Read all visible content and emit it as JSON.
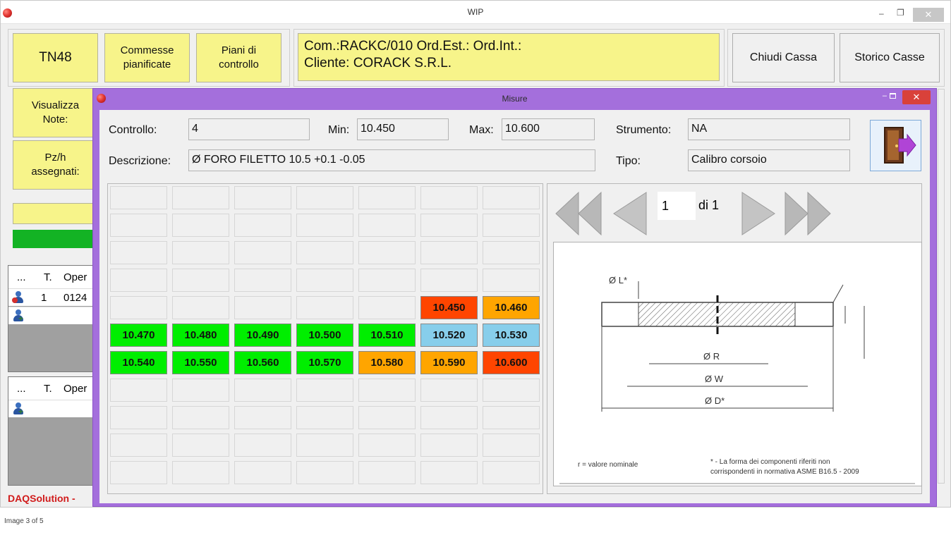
{
  "main": {
    "title": "WIP",
    "minimize_label": "–",
    "maximize_label": "❐",
    "close_label": "✕",
    "machine_btn": "TN48",
    "commesse_btn": "Commesse pianificate",
    "piani_btn": "Piani di controllo",
    "info_line1": "Com.:RACKC/010  Ord.Est.:  Ord.Int.:",
    "info_line2": "Cliente: CORACK S.R.L.",
    "chiudi_cassa": "Chiudi Cassa",
    "storico_casse": "Storico Casse",
    "visualizza_note": "Visualizza Note:",
    "pzh_assegnati": "Pz/h assegnati:",
    "grid1": {
      "col_dots": "...",
      "col_t": "T.",
      "col_oper": "Oper",
      "row1_t": "1",
      "row1_oper": "0124"
    },
    "grid2": {
      "col_dots": "...",
      "col_t": "T.",
      "col_oper": "Oper"
    },
    "status_text": "DAQSolution  -"
  },
  "dialog": {
    "title": "Misure",
    "controllo_label": "Controllo:",
    "controllo_value": "4",
    "min_label": "Min:",
    "min_value": "10.450",
    "max_label": "Max:",
    "max_value": "10.600",
    "strumento_label": "Strumento:",
    "strumento_value": "NA",
    "descrizione_label": "Descrizione:",
    "descrizione_value": "Ø FORO FILETTO 10.5 +0.1 -0.05",
    "tipo_label": "Tipo:",
    "tipo_value": "Calibro corsoio",
    "exit_icon": "exit-door-icon",
    "page_current": "1",
    "page_of": "di 1",
    "drawing": {
      "label_L": "Ø  L*",
      "label_R": "Ø  R",
      "label_W": "Ø  W",
      "label_D": "Ø  D*",
      "note_left": "r = valore nominale",
      "note_right_1": "* - La forma dei componenti riferiti non",
      "note_right_2": "corrispondenti in normativa ASME B16.5 - 2009"
    },
    "measures": [
      {
        "value": "10.450",
        "color": "#ff4500"
      },
      {
        "value": "10.460",
        "color": "#ffa500"
      },
      {
        "value": "10.470",
        "color": "#00ee00"
      },
      {
        "value": "10.480",
        "color": "#00ee00"
      },
      {
        "value": "10.490",
        "color": "#00ee00"
      },
      {
        "value": "10.500",
        "color": "#00ee00"
      },
      {
        "value": "10.510",
        "color": "#00ee00"
      },
      {
        "value": "10.520",
        "color": "#87ceeb"
      },
      {
        "value": "10.530",
        "color": "#87ceeb"
      },
      {
        "value": "10.540",
        "color": "#00ee00"
      },
      {
        "value": "10.550",
        "color": "#00ee00"
      },
      {
        "value": "10.560",
        "color": "#00ee00"
      },
      {
        "value": "10.570",
        "color": "#00ee00"
      },
      {
        "value": "10.580",
        "color": "#ffa500"
      },
      {
        "value": "10.590",
        "color": "#ffa500"
      },
      {
        "value": "10.600",
        "color": "#ff4500"
      }
    ]
  },
  "footer": {
    "caption": "Image 3 of 5"
  }
}
